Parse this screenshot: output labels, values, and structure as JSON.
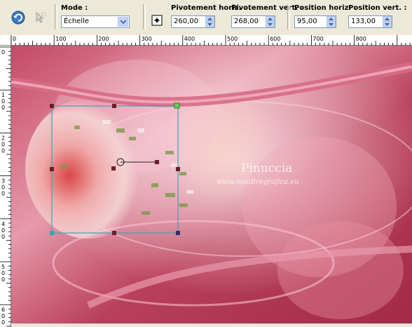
{
  "toolbar": {
    "mode_label": "Mode :",
    "mode_value": "Échelle",
    "pivot_h_label": "Pivotement horiz. :",
    "pivot_h_value": "260,00",
    "pivot_v_label": "Pivotement vert. :",
    "pivot_v_value": "268,00",
    "pos_h_label": "Position horiz. :",
    "pos_h_value": "95,00",
    "pos_v_label": "Position vert. :",
    "pos_v_value": "133,00"
  },
  "ruler": {
    "h_ticks": [
      "0",
      "100",
      "200",
      "300",
      "400",
      "500",
      "600",
      "700",
      "800"
    ],
    "v_ticks": [
      "0",
      "100",
      "200",
      "300",
      "400",
      "500",
      "600"
    ]
  },
  "watermark": {
    "title": "Pinuccia",
    "url": "www.maidiregrafica.eu"
  },
  "colors": {
    "toolbar_bg": "#ece9d8",
    "canvas_base": "#b94560",
    "handle": "#6b1e2a",
    "bbox_line": "#2fa8b0",
    "pivot_handle": "#5fd15b"
  }
}
